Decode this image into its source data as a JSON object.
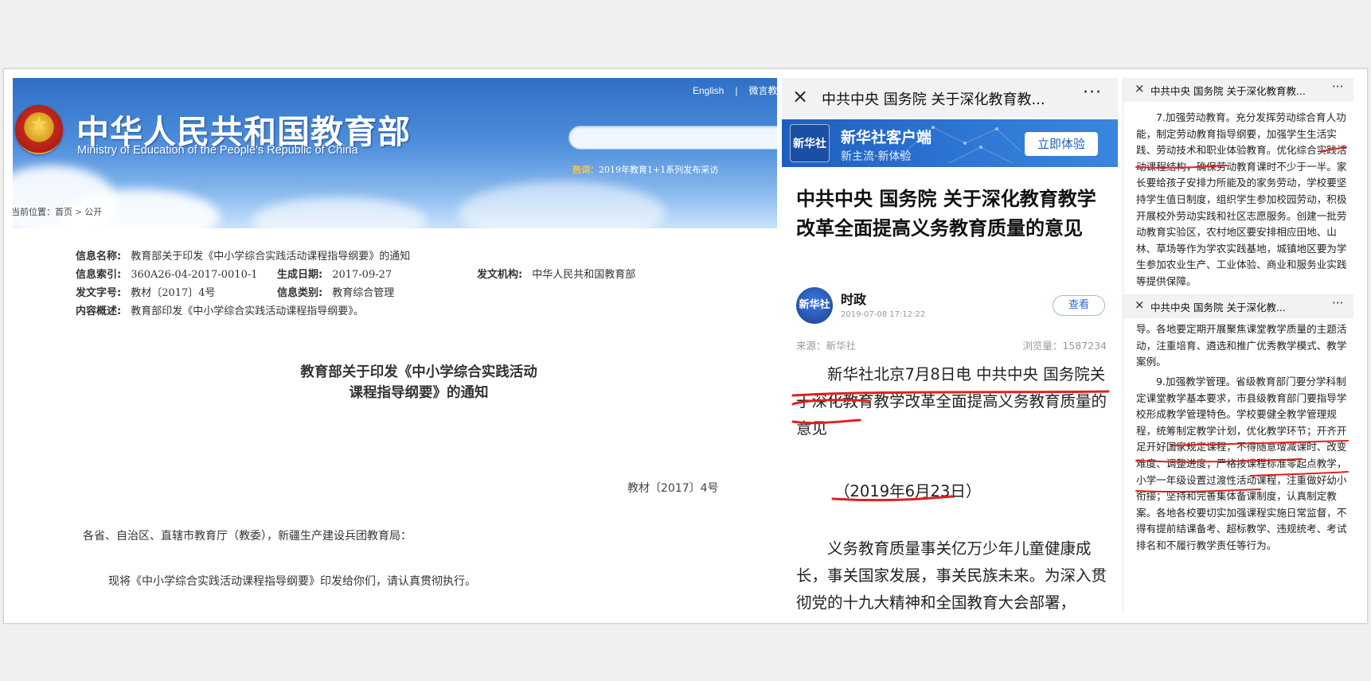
{
  "moe": {
    "title_cn": "中华人民共和国教育部",
    "title_en": "Ministry of Education of the People's Republic of China",
    "lang_english": "English",
    "lang_sep": "|",
    "lang_weibo": "微言教",
    "hot_label": "热词：",
    "hot_text": "2019年教育1+1系列发布采访",
    "breadcrumb_prefix": "当前位置：",
    "breadcrumb_home": "首页",
    "breadcrumb_sep": ">",
    "breadcrumb_current": "公开",
    "meta": {
      "name_k": "信息名称:",
      "name_v": "教育部关于印发《中小学综合实践活动课程指导纲要》的通知",
      "index_k": "信息索引:",
      "index_v": "360A26-04-2017-0010-1",
      "date_k": "生成日期:",
      "date_v": "2017-09-27",
      "org_k": "发文机构:",
      "org_v": "中华人民共和国教育部",
      "docno_k": "发文字号:",
      "docno_v": "教材〔2017〕4号",
      "type_k": "信息类别:",
      "type_v": "教育综合管理",
      "summary_k": "内容概述:",
      "summary_v": "教育部印发《中小学综合实践活动课程指导纲要》。"
    },
    "doc_title_line1": "教育部关于印发《中小学综合实践活动",
    "doc_title_line2": "课程指导纲要》的通知",
    "doc_number": "教材〔2017〕4号",
    "salutation": "各省、自治区、直辖市教育厅（教委），新疆生产建设兵团教育局：",
    "body": "现将《中小学综合实践活动课程指导纲要》印发给你们，请认真贯彻执行。"
  },
  "xinhua": {
    "topbar_title": "中共中央 国务院 关于深化教育教...",
    "close_icon": "×",
    "more_icon": "···",
    "banner_logo": "新华社",
    "banner_name": "新华社客户端",
    "banner_slogan": "新主流·新体验",
    "banner_button": "立即体验",
    "headline": "中共中央 国务院 关于深化教育教学改革全面提高义务教育质量的意见",
    "author": "时政",
    "author_avatar": "新华社",
    "date": "2019-07-08 17:12:22",
    "view_button": "查看",
    "source": "来源：新华社",
    "views": "浏览量：1587234",
    "para1": "新华社北京7月8日电 中共中央 国务院关于深化教育教学改革全面提高义务教育质量的意见",
    "para_date": "（2019年6月23日）",
    "para2": "义务教育质量事关亿万少年儿童健康成长，事关国家发展，事关民族未来。为深入贯彻党的十九大精神和全国教育大会部署，"
  },
  "right_panel": {
    "bar1_title": "中共中央 国务院 关于深化教育教...",
    "bar2_title": "中共中央 国务院 关于深化教...",
    "close_icon": "×",
    "more_icon": "···",
    "text1": "7.加强劳动教育。充分发挥劳动综合育人功能，制定劳动教育指导纲要，加强学生生活实践、劳动技术和职业体验教育。优化综合实践活动课程结构，确保劳动教育课时不少于一半。家长要给孩子安排力所能及的家务劳动，学校要坚持学生值日制度，组织学生参加校园劳动，积极开展校外劳动实践和社区志愿服务。创建一批劳动教育实验区，农村地区要安排相应田地、山林、草场等作为学农实践基地，城镇地区要为学生参加农业生产、工业体验、商业和服务业实践等提供保障。",
    "text2": "导。各地要定期开展聚焦课堂教学质量的主题活动，注重培育、遴选和推广优秀教学模式、教学案例。",
    "text3": "9.加强教学管理。省级教育部门要分学科制定课堂教学基本要求，市县级教育部门要指导学校形成教学管理特色。学校要健全教学管理规程，统筹制定教学计划，优化教学环节；开齐开足开好国家规定课程，不得随意增减课时、改变难度、调整进度；严格按课程标准零起点教学，小学一年级设置过渡性活动课程，注重做好幼小衔接；坚持和完善集体备课制度，认真制定教案。各地各校要切实加强课程实施日常监督，不得有提前结课备考、超标教学、违规统考、考试排名和不履行教学责任等行为。"
  },
  "colors": {
    "header_blue": "#2f6fc6",
    "xinhua_blue": "#1d5fbe",
    "ink_red": "#e0201e"
  }
}
